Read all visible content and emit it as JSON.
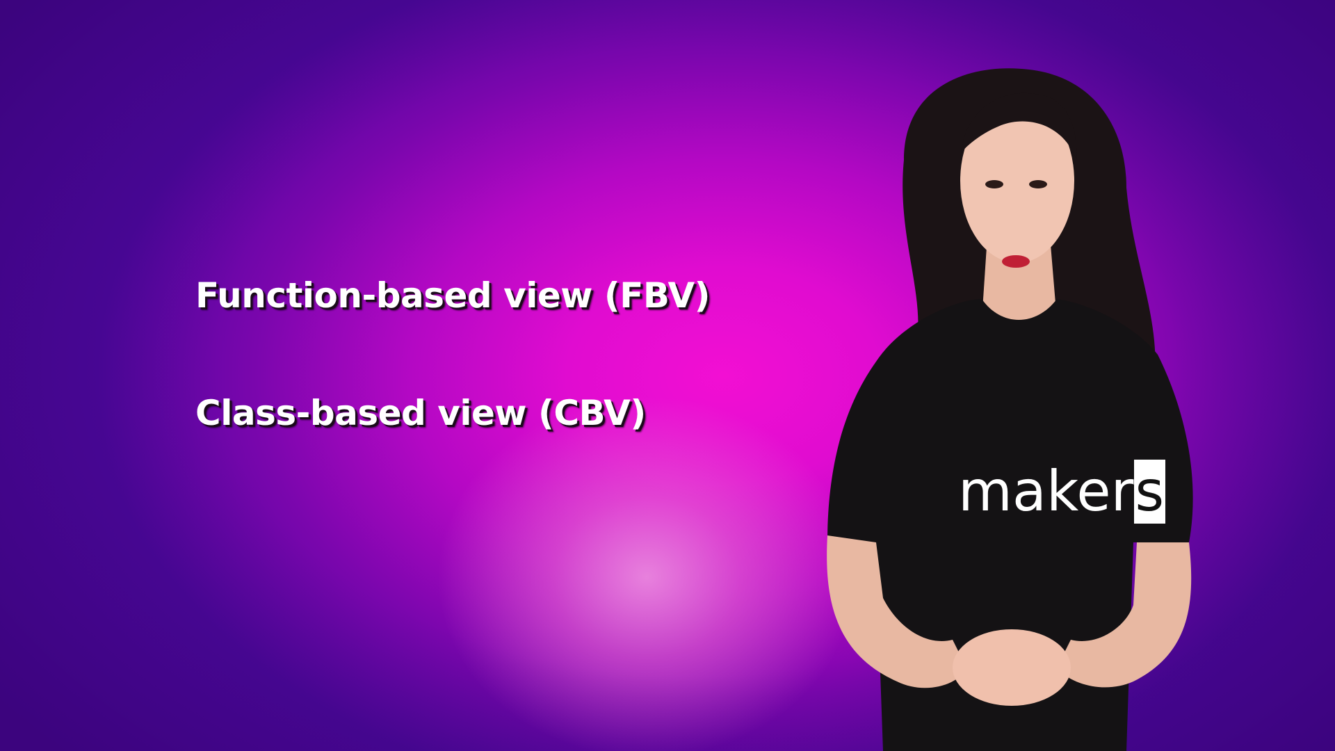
{
  "slide": {
    "lines": [
      "Function-based view (FBV)",
      "Class-based view (CBV)"
    ]
  },
  "presenter": {
    "shirt_logo_main": "maker",
    "shirt_logo_last": "s"
  },
  "colors": {
    "background_center": "#f20fd3",
    "background_edge": "#4a0a98",
    "text": "#ffffff",
    "shirt": "#141214"
  }
}
